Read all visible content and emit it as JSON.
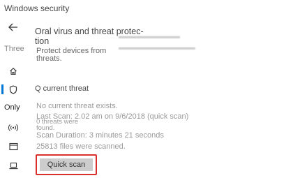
{
  "window": {
    "title": "Windows security"
  },
  "sidebar": {
    "back_icon": "back-arrow-icon",
    "items": [
      {
        "label": "Three"
      },
      {
        "icon": "home-icon"
      },
      {
        "icon": "shield-icon",
        "selected": true
      },
      {
        "label": "Only"
      },
      {
        "icon": "wireless-icon"
      },
      {
        "icon": "app-browser-icon"
      },
      {
        "icon": "laptop-icon"
      }
    ]
  },
  "main": {
    "heading": "Oral virus and threat protec- tion",
    "subtitle": "Protect devices from threats.",
    "section_title": "Q current threat",
    "status": "No current threat exists.",
    "last_scan": "Last Scan: 2.02 am on 9/6/2018 (quick scan)",
    "threats_found": "0 threats were found.",
    "scan_duration": "Scan Duration: 3 minutes 21 seconds",
    "files_scanned": "25813 files were scanned.",
    "quick_scan_label": "Quick scan"
  },
  "colors": {
    "accent": "#0078d7",
    "highlight_border": "#d9302c",
    "button_bg": "#cccccc"
  }
}
